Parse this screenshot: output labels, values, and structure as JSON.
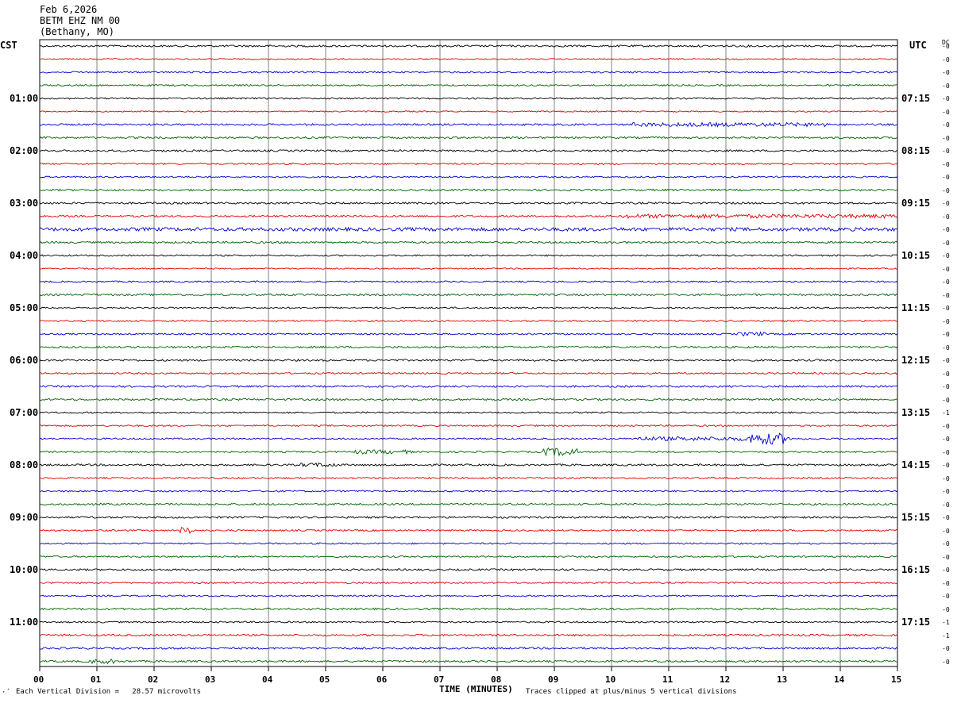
{
  "header": {
    "date": "Feb 6,2026",
    "station": "BETM EHZ NM 00",
    "location": "(Bethany, MO)"
  },
  "left_tz": "CST",
  "right_tz": "UTC",
  "dc_label": "DC",
  "footer": {
    "corner_mark": "·´",
    "scale_note": "Each Vertical Division =   28.57 microvolts",
    "x_title": "TIME (MINUTES)",
    "clip_note": "Traces clipped at plus/minus 5 vertical divisions"
  },
  "colors": {
    "black": "#000000",
    "red": "#e00000",
    "blue": "#0000d0",
    "green": "#006400",
    "grid": "#808080"
  },
  "chart_data": {
    "type": "line",
    "x_ticks": [
      "00",
      "01",
      "02",
      "03",
      "04",
      "05",
      "06",
      "07",
      "08",
      "09",
      "10",
      "11",
      "12",
      "13",
      "14",
      "15"
    ],
    "xlim": [
      0,
      15
    ],
    "minutes_per_line": 15,
    "trace_count": 48,
    "color_cycle": [
      "black",
      "red",
      "blue",
      "green"
    ],
    "left_hour_labels": [
      "01:00",
      "02:00",
      "03:00",
      "04:00",
      "05:00",
      "06:00",
      "07:00",
      "08:00",
      "09:00",
      "10:00",
      "11:00"
    ],
    "right_hour_labels": [
      "07:15",
      "08:15",
      "09:15",
      "10:15",
      "11:15",
      "12:15",
      "13:15",
      "14:15",
      "15:15",
      "16:15",
      "17:15"
    ],
    "dc_offsets": [
      "-0",
      "-0",
      "-0",
      "-0",
      "-0",
      "-0",
      "-0",
      "-0",
      "-0",
      "-0",
      "-0",
      "-0",
      "-0",
      "-0",
      "-0",
      "-0",
      "-0",
      "-0",
      "-0",
      "-0",
      "-0",
      "-0",
      "-0",
      "-0",
      "-0",
      "-0",
      "-0",
      "-0",
      "-1",
      "-0",
      "-0",
      "-0",
      "-0",
      "-0",
      "-0",
      "-0",
      "-0",
      "-0",
      "-0",
      "-0",
      "-0",
      "-0",
      "-0",
      "-0",
      "-1",
      "-1",
      "-0",
      "-0"
    ],
    "noise_amplitude": [
      1.2,
      0.8,
      1.0,
      1.0,
      1.0,
      0.8,
      1.2,
      1.2,
      1.2,
      1.0,
      1.0,
      1.2,
      1.2,
      1.2,
      2.2,
      1.2,
      1.0,
      0.8,
      1.0,
      1.2,
      1.0,
      1.0,
      1.0,
      1.2,
      1.2,
      1.0,
      1.2,
      1.2,
      1.0,
      1.0,
      1.0,
      1.0,
      1.2,
      1.0,
      1.0,
      1.2,
      1.2,
      1.0,
      1.0,
      1.0,
      1.2,
      1.0,
      1.0,
      1.2,
      1.0,
      1.2,
      1.2,
      1.2
    ],
    "events": [
      {
        "trace": 6,
        "start_min": 10.3,
        "end_min": 13.8,
        "amplitude": 2.5
      },
      {
        "trace": 13,
        "start_min": 10.2,
        "end_min": 15.0,
        "amplitude": 2.5
      },
      {
        "trace": 22,
        "start_min": 12.2,
        "end_min": 12.7,
        "amplitude": 2.5
      },
      {
        "trace": 30,
        "start_min": 10.4,
        "end_min": 13.2,
        "amplitude": 2.5
      },
      {
        "trace": 30,
        "start_min": 12.4,
        "end_min": 13.0,
        "amplitude": 7
      },
      {
        "trace": 31,
        "start_min": 8.8,
        "end_min": 9.4,
        "amplitude": 5
      },
      {
        "trace": 31,
        "start_min": 5.5,
        "end_min": 6.5,
        "amplitude": 2.5
      },
      {
        "trace": 32,
        "start_min": 4.5,
        "end_min": 5.2,
        "amplitude": 2.5
      },
      {
        "trace": 37,
        "start_min": 2.4,
        "end_min": 2.7,
        "amplitude": 4
      },
      {
        "trace": 47,
        "start_min": 0.9,
        "end_min": 1.3,
        "amplitude": 3
      }
    ]
  }
}
